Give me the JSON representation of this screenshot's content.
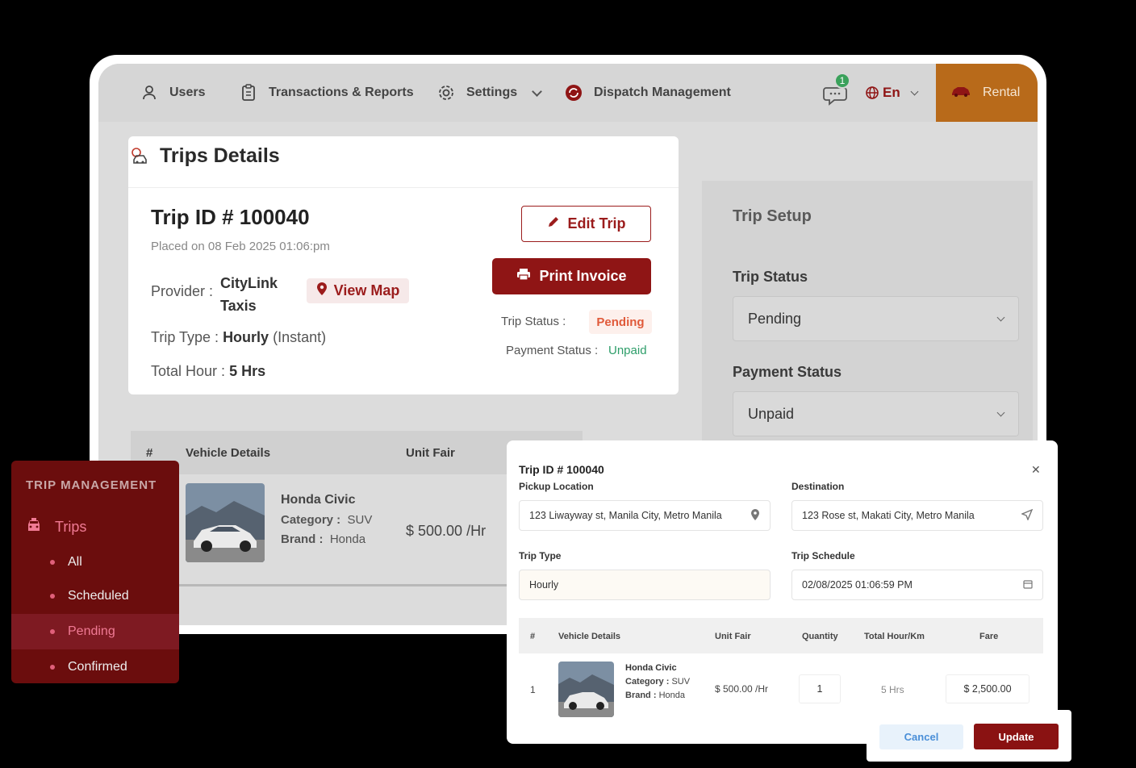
{
  "nav": {
    "users": "Users",
    "transactions": "Transactions & Reports",
    "settings": "Settings",
    "dispatch": "Dispatch Management",
    "notif_count": "1",
    "language": "En",
    "rental": "Rental"
  },
  "details": {
    "title": "Trips Details",
    "trip_id": "Trip ID # 100040",
    "placed_on": "Placed on 08 Feb 2025 01:06:pm",
    "provider_label": "Provider :",
    "provider_line1": "CityLink",
    "provider_line2": "Taxis",
    "view_map": "View Map",
    "trip_type_label": "Trip Type :",
    "trip_type_value": "Hourly",
    "trip_type_suffix": "(Instant)",
    "total_hour_label": "Total Hour :",
    "total_hour_value": "5 Hrs",
    "edit_trip": "Edit Trip",
    "print_invoice": "Print Invoice",
    "trip_status_label": "Trip Status :",
    "trip_status_value": "Pending",
    "payment_status_label": "Payment Status :",
    "payment_status_value": "Unpaid"
  },
  "setup": {
    "title": "Trip Setup",
    "trip_status_label": "Trip Status",
    "trip_status_value": "Pending",
    "payment_status_label": "Payment Status",
    "payment_status_value": "Unpaid"
  },
  "table": {
    "col_num": "#",
    "col_vehicle": "Vehicle Details",
    "col_unit": "Unit Fair",
    "vehicle_name": "Honda Civic",
    "category_label": "Category :",
    "category_value": "SUV",
    "brand_label": "Brand :",
    "brand_value": "Honda",
    "unit_fair": "$ 500.00 /Hr"
  },
  "sidebar": {
    "heading": "TRIP MANAGEMENT",
    "trips": "Trips",
    "items": [
      "All",
      "Scheduled",
      "Pending",
      "Confirmed"
    ]
  },
  "modal": {
    "title": "Trip ID # 100040",
    "pickup_label": "Pickup Location",
    "pickup_value": "123 Liwayway st, Manila City, Metro Manila",
    "destination_label": "Destination",
    "destination_value": "123 Rose st, Makati City, Metro Manila",
    "trip_type_label": "Trip Type",
    "trip_type_value": "Hourly",
    "schedule_label": "Trip Schedule",
    "schedule_value": "02/08/2025 01:06:59 PM",
    "headers": [
      "#",
      "Vehicle Details",
      "Unit Fair",
      "Quantity",
      "Total Hour/Km",
      "Fare"
    ],
    "row_num": "1",
    "vehicle_name": "Honda Civic",
    "category_label": "Category :",
    "category_value": "SUV",
    "brand_label": "Brand :",
    "brand_value": "Honda",
    "unit_fair": "$ 500.00 /Hr",
    "quantity": "1",
    "total_hour": "5 Hrs",
    "fare": "$ 2,500.00",
    "cancel": "Cancel",
    "update": "Update"
  },
  "colors": {
    "brand_red": "#8f1515",
    "sidebar_bg": "#6b0d0d",
    "rental_orange": "#b86a1a",
    "pending": "#e05a3a",
    "unpaid": "#2e9e6a",
    "badge_green": "#3aa15b"
  }
}
